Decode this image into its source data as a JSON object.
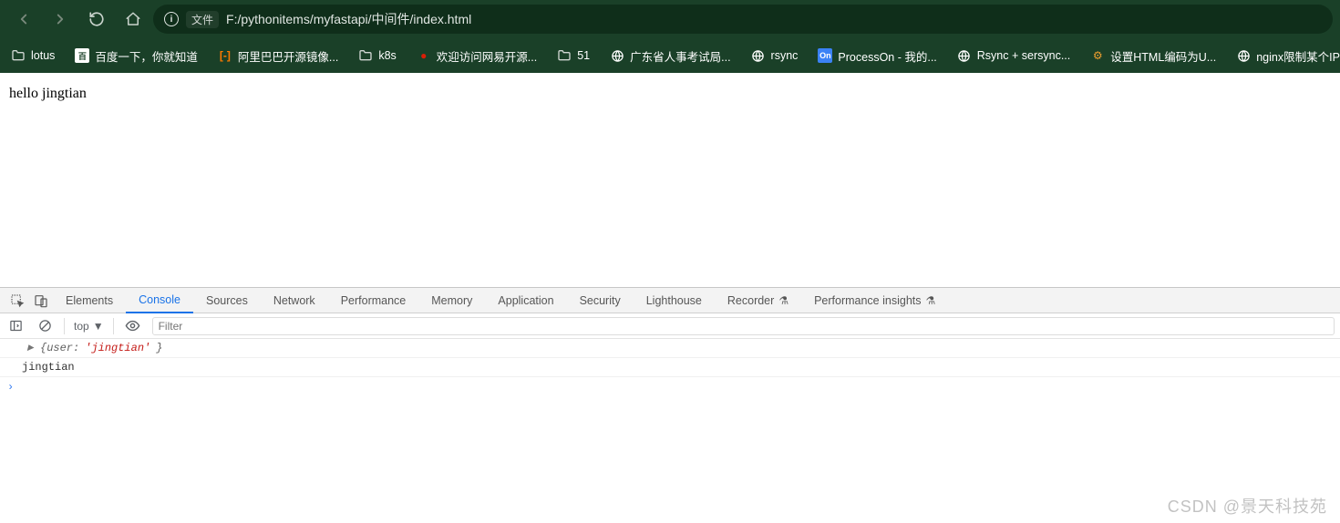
{
  "browser": {
    "url_chip": "文件",
    "url_path": "F:/pythonitems/myfastapi/中间件/index.html"
  },
  "bookmarks": [
    {
      "icon": "folder",
      "label": "lotus"
    },
    {
      "icon": "baidu",
      "label": "百度一下，你就知道"
    },
    {
      "icon": "aliyun",
      "label": "阿里巴巴开源镜像..."
    },
    {
      "icon": "folder",
      "label": "k8s"
    },
    {
      "icon": "netease",
      "label": "欢迎访问网易开源..."
    },
    {
      "icon": "folder",
      "label": "51"
    },
    {
      "icon": "globe",
      "label": "广东省人事考试局..."
    },
    {
      "icon": "globe",
      "label": "rsync"
    },
    {
      "icon": "processon",
      "label": "ProcessOn - 我的..."
    },
    {
      "icon": "globe",
      "label": "Rsync + sersync..."
    },
    {
      "icon": "gear",
      "label": "设置HTML编码为U..."
    },
    {
      "icon": "globe",
      "label": "nginx限制某个IP同..."
    }
  ],
  "page": {
    "text": "hello jingtian"
  },
  "devtools": {
    "tabs": [
      "Elements",
      "Console",
      "Sources",
      "Network",
      "Performance",
      "Memory",
      "Application",
      "Security",
      "Lighthouse",
      "Recorder",
      "Performance insights"
    ],
    "active_tab": "Console",
    "context": "top",
    "filter_placeholder": "Filter",
    "console_obj_prefix": "{user: ",
    "console_obj_value": "'jingtian'",
    "console_obj_suffix": "}",
    "console_line2": "jingtian"
  },
  "watermark": "CSDN @景天科技苑"
}
